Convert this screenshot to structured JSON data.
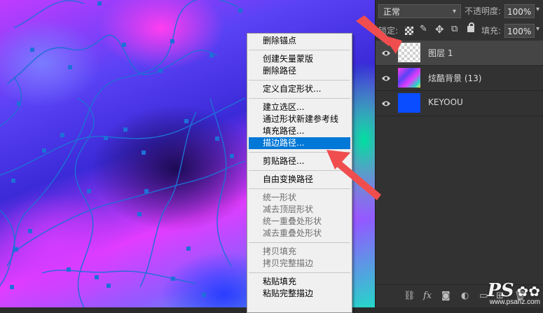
{
  "context_menu": {
    "groups": [
      [
        {
          "label": "删除锚点",
          "enabled": true
        }
      ],
      [
        {
          "label": "创建矢量蒙版",
          "enabled": true
        },
        {
          "label": "删除路径",
          "enabled": true
        }
      ],
      [
        {
          "label": "定义自定形状...",
          "enabled": true
        }
      ],
      [
        {
          "label": "建立选区...",
          "enabled": true
        },
        {
          "label": "通过形状新建参考线",
          "enabled": true
        },
        {
          "label": "填充路径...",
          "enabled": true
        },
        {
          "label": "描边路径...",
          "enabled": true,
          "highlighted": true
        }
      ],
      [
        {
          "label": "剪贴路径...",
          "enabled": true
        }
      ],
      [
        {
          "label": "自由变换路径",
          "enabled": true
        }
      ],
      [
        {
          "label": "统一形状",
          "enabled": false
        },
        {
          "label": "减去顶层形状",
          "enabled": false
        },
        {
          "label": "统一重叠处形状",
          "enabled": false
        },
        {
          "label": "减去重叠处形状",
          "enabled": false
        }
      ],
      [
        {
          "label": "拷贝填充",
          "enabled": false
        },
        {
          "label": "拷贝完整描边",
          "enabled": false
        }
      ],
      [
        {
          "label": "粘贴填充",
          "enabled": true
        },
        {
          "label": "粘贴完整描边",
          "enabled": true
        }
      ]
    ]
  },
  "layers_panel": {
    "blend_mode": "正常",
    "opacity_label": "不透明度:",
    "opacity_value": "100%",
    "lock_label": "锁定:",
    "fill_label": "填充:",
    "fill_value": "100%",
    "layers": [
      {
        "name": "图层 1",
        "visible": true,
        "selected": true,
        "thumb": "transparent"
      },
      {
        "name": "炫酷背景 (13)",
        "visible": true,
        "selected": false,
        "thumb": "image"
      },
      {
        "name": "KEYOOU",
        "visible": true,
        "selected": false,
        "thumb": "#0a4cff"
      }
    ],
    "bottom_icons": [
      "link-icon",
      "fx-icon",
      "mask-icon",
      "adjustment-icon",
      "folder-icon",
      "new-layer-icon",
      "trash-icon"
    ]
  },
  "watermark": {
    "brand": "PS",
    "site": "www.psahz.com"
  },
  "colors": {
    "accent": "#0078d7",
    "arrow": "#f04e4e",
    "path": "#1e6fd8"
  }
}
